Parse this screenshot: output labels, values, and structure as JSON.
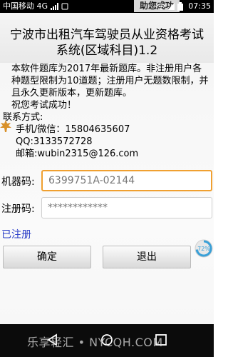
{
  "status_bar": {
    "carrier": "中国移动 4G",
    "toast": "助您成功",
    "time": "07:35"
  },
  "header": {
    "title_line1": "宁波市出租汽车驾驶员从业资格考试",
    "title_line2": "系统(区域科目)1.2"
  },
  "intro": {
    "paragraph1": "本软件题库为2017年最新题库。非注册用户各种题型限制为10道题；注册用户无题数限制，并且永久更新版本，更新题库。",
    "wish": "祝您考试成功！",
    "contact_title": "联系方式:",
    "phone": "手机/微信：15804635607",
    "qq": "QQ:3133572728",
    "email": "邮箱:wubin2315@126.com"
  },
  "form": {
    "machine_label": "机器码:",
    "machine_value": "6399751A-02144",
    "reg_label": "注册码:",
    "reg_value": "************"
  },
  "status": {
    "registered": "已注册"
  },
  "buttons": {
    "ok": "确定",
    "exit": "退出"
  },
  "badge": {
    "percent": "72%"
  },
  "watermark": "乐享轻汇 • NYCQH.COM",
  "colors": {
    "status_bar": "#000000",
    "machine_border": "#f0a030",
    "registered_text": "#2a3ec8"
  }
}
